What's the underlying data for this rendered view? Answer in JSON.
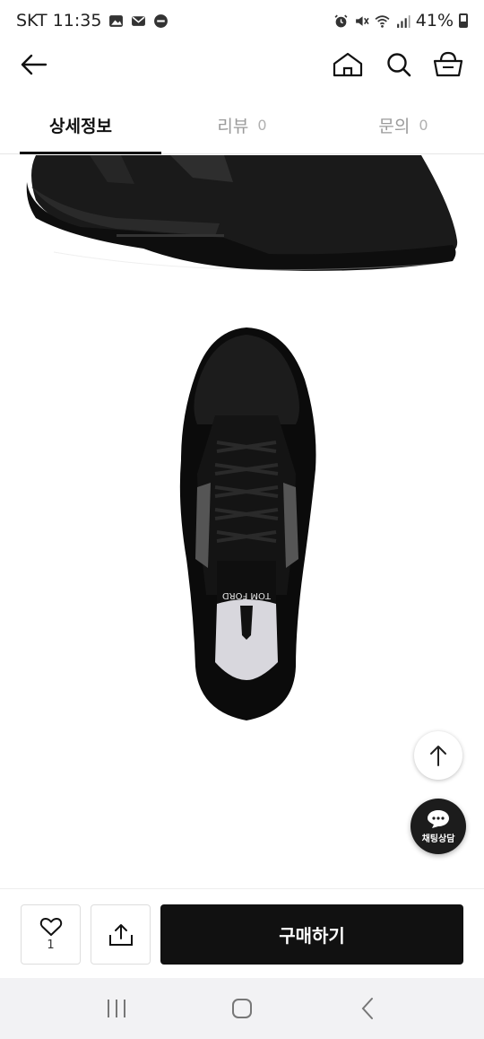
{
  "status_bar": {
    "carrier_time": "SKT 11:35",
    "battery": "41%",
    "battery_level": 0.41
  },
  "app_bar": {
    "back_icon": "arrow-left-icon",
    "home_icon": "home-icon",
    "search_icon": "search-icon",
    "cart_icon": "basket-icon"
  },
  "tabs": [
    {
      "label": "상세정보",
      "count": "",
      "active": true
    },
    {
      "label": "리뷰",
      "count": "0",
      "active": false
    },
    {
      "label": "문의",
      "count": "0",
      "active": false
    }
  ],
  "product_images": {
    "brand_label": "TOM FORD"
  },
  "floating": {
    "chat_label": "채팅상담",
    "scroll_top_icon": "arrow-up-icon"
  },
  "action_bar": {
    "like_count": "1",
    "buy_label": "구매하기"
  }
}
